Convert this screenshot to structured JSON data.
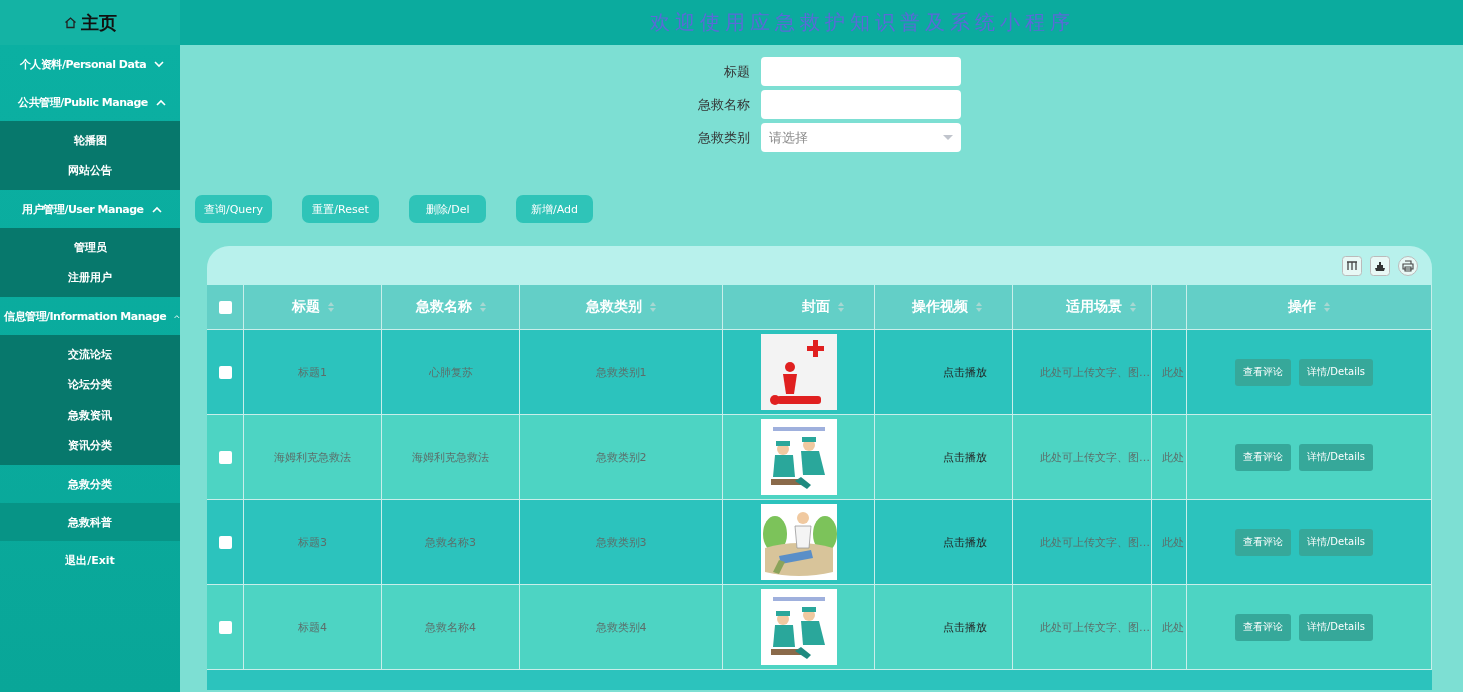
{
  "header": {
    "home": "主页",
    "title": "欢迎使用应急救护知识普及系统小程序"
  },
  "sidebar": {
    "items": [
      {
        "kind": "group",
        "label": "个人资料/Personal Data",
        "expanded": false
      },
      {
        "kind": "group",
        "label": "公共管理/Public Manage",
        "expanded": true,
        "children": [
          {
            "label": "轮播图"
          },
          {
            "label": "网站公告"
          }
        ]
      },
      {
        "kind": "group",
        "label": "用户管理/User Manage",
        "expanded": true,
        "children": [
          {
            "label": "管理员"
          },
          {
            "label": "注册用户"
          }
        ]
      },
      {
        "kind": "group",
        "label": "信息管理/Information Manage",
        "expanded": true,
        "children": [
          {
            "label": "交流论坛"
          },
          {
            "label": "论坛分类"
          },
          {
            "label": "急救资讯"
          },
          {
            "label": "资讯分类"
          }
        ]
      },
      {
        "kind": "item",
        "label": "急救分类",
        "selected": false
      },
      {
        "kind": "item",
        "label": "急救科普",
        "selected": true
      },
      {
        "kind": "item",
        "label": "退出/Exit",
        "selected": false
      }
    ]
  },
  "search": {
    "fields": [
      {
        "kind": "text",
        "label": "标题"
      },
      {
        "kind": "text",
        "label": "急救名称"
      },
      {
        "kind": "select",
        "label": "急救类别",
        "placeholder": "请选择"
      }
    ]
  },
  "buttons": [
    "查询/Query",
    "重置/Reset",
    "删除/Del",
    "新增/Add"
  ],
  "table": {
    "all_checked": false,
    "columns": [
      "标题",
      "急救名称",
      "急救类别",
      "封面",
      "操作视频",
      "适用场景",
      "操作"
    ],
    "rows": [
      {
        "checked": false,
        "title": "标题1",
        "name": "心肺复苏",
        "category": "急救类别1",
        "video": "点击播放",
        "scene": "此处可上传文字、图…",
        "column_8": "此处",
        "actions": [
          "查看评论",
          "详情/Details"
        ]
      },
      {
        "checked": false,
        "title": "海姆利克急救法",
        "name": "海姆利克急救法",
        "category": "急救类别2",
        "video": "点击播放",
        "scene": "此处可上传文字、图…",
        "column_8": "此处",
        "actions": [
          "查看评论",
          "详情/Details"
        ]
      },
      {
        "checked": false,
        "title": "标题3",
        "name": "急救名称3",
        "category": "急救类别3",
        "video": "点击播放",
        "scene": "此处可上传文字、图…",
        "column_8": "此处",
        "actions": [
          "查看评论",
          "详情/Details"
        ]
      },
      {
        "checked": false,
        "title": "标题4",
        "name": "急救名称4",
        "category": "急救类别4",
        "video": "点击播放",
        "scene": "此处可上传文字、图…",
        "column_8": "此处",
        "actions": [
          "查看评论",
          "详情/Details"
        ]
      }
    ]
  }
}
